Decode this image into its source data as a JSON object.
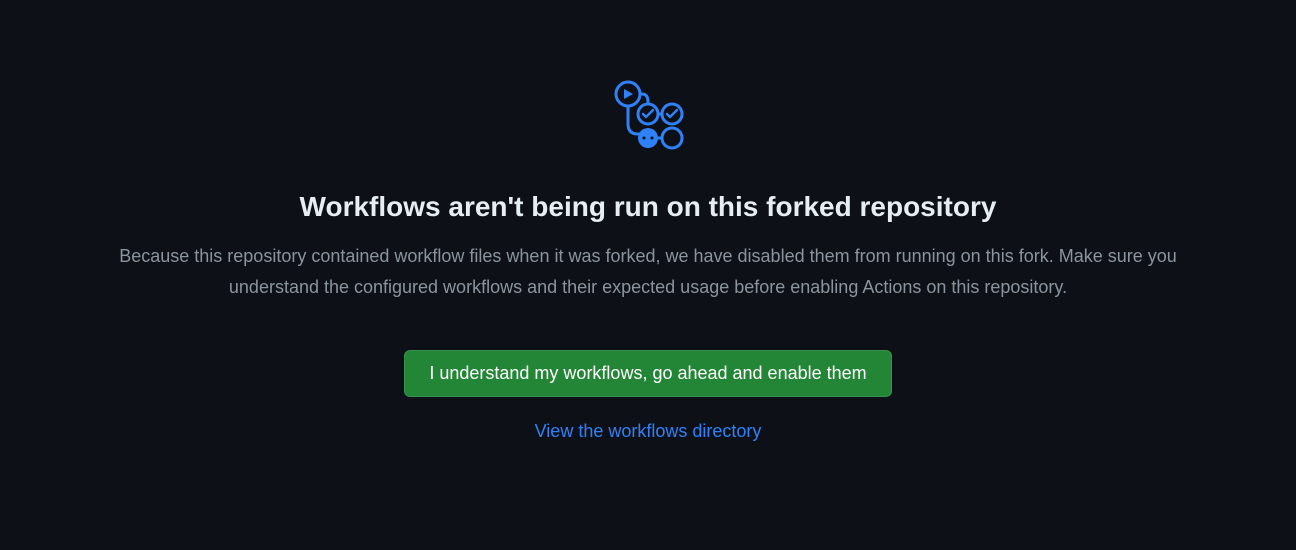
{
  "heading": "Workflows aren't being run on this forked repository",
  "description": "Because this repository contained workflow files when it was forked, we have disabled them from running on this fork. Make sure you understand the configured workflows and their expected usage before enabling Actions on this repository.",
  "button_label": "I understand my workflows, go ahead and enable them",
  "link_label": "View the workflows directory"
}
